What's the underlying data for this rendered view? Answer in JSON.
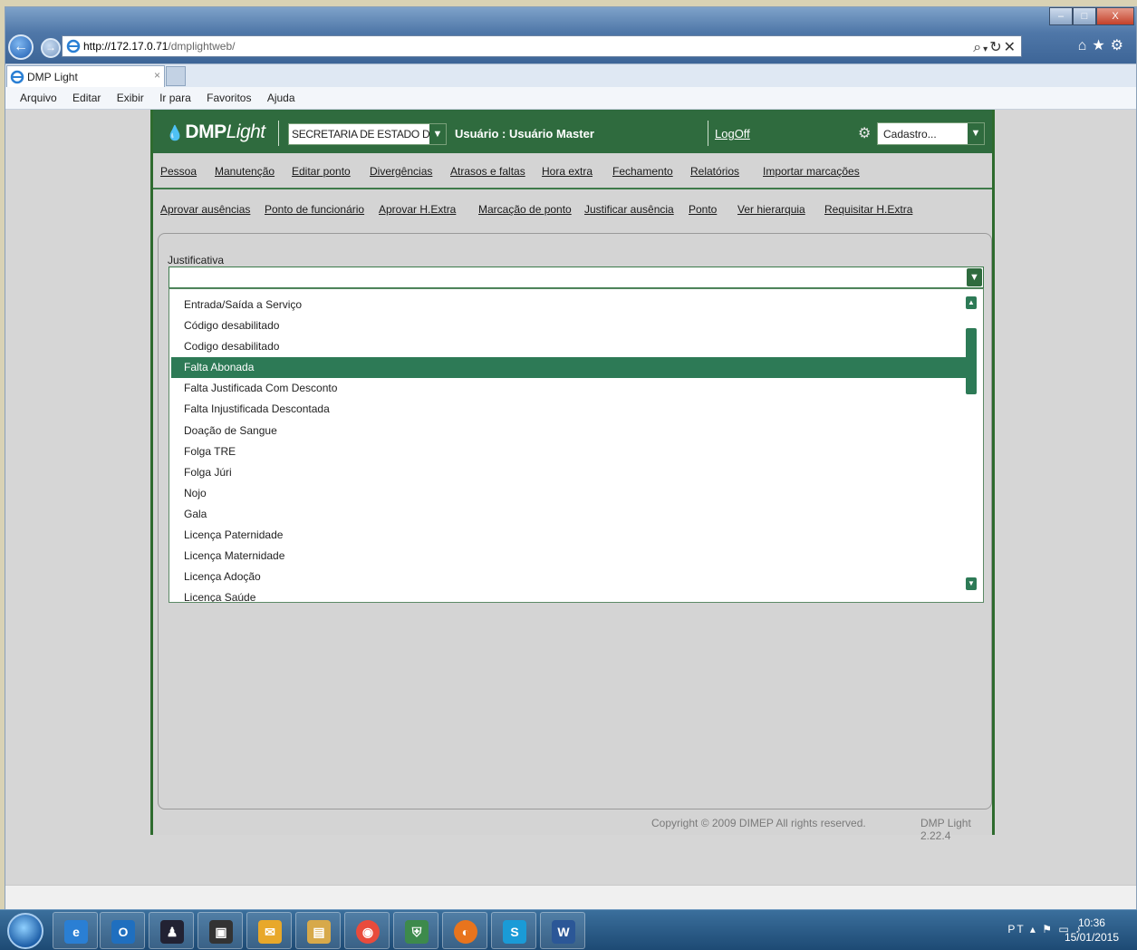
{
  "browser": {
    "url_host": "http://172.17.0.71",
    "url_path": "/dmplightweb/",
    "tab_title": "DMP Light",
    "tab_close": "×",
    "win_buttons": [
      "–",
      "□",
      "X"
    ],
    "menu": [
      "Arquivo",
      "Editar",
      "Exibir",
      "Ir para",
      "Favoritos",
      "Ajuda"
    ]
  },
  "app": {
    "logo_main": "DMP",
    "logo_italic": "Light",
    "org_select_value": "SECRETARIA DE ESTADO DA SAÚ",
    "user_label": "Usuário : Usuário Master",
    "logoff": "LogOff",
    "cadastro_select_value": "Cadastro..."
  },
  "menu_row1": [
    "Pessoa",
    "Manutenção",
    "Editar ponto",
    "Divergências",
    "Atrasos e faltas",
    "Hora extra",
    "Fechamento",
    "Relatórios",
    "Importar marcações"
  ],
  "menu_row2": [
    "Aprovar ausências",
    "Ponto de funcionário",
    "Aprovar H.Extra",
    "Marcação de ponto",
    "Justificar ausência",
    "Ponto",
    "Ver hierarquia",
    "Requisitar H.Extra"
  ],
  "form": {
    "justificativa_label": "Justificativa",
    "justificativa_value": ""
  },
  "dropdown": {
    "options": [
      "Entrada/Saída a Serviço",
      "Código desabilitado",
      "Codigo desabilitado",
      "Falta Abonada",
      "Falta Justificada Com Desconto",
      "Falta Injustificada Descontada",
      "Doação de Sangue",
      "Folga TRE",
      "Folga Júri",
      "Nojo",
      "Gala",
      "Licença Paternidade",
      "Licença Maternidade",
      "Licença Adoção",
      "Licença Saúde"
    ],
    "selected": "Falta Abonada"
  },
  "footer": {
    "copyright": "Copyright © 2009 DIMEP All rights reserved.",
    "version": "DMP Light 2.22.4"
  },
  "taskbar": {
    "language": "PT",
    "time": "10:36",
    "date": "15/01/2015"
  },
  "colors": {
    "app_green": "#2f6b3e",
    "selection_green": "#2d7a56"
  }
}
